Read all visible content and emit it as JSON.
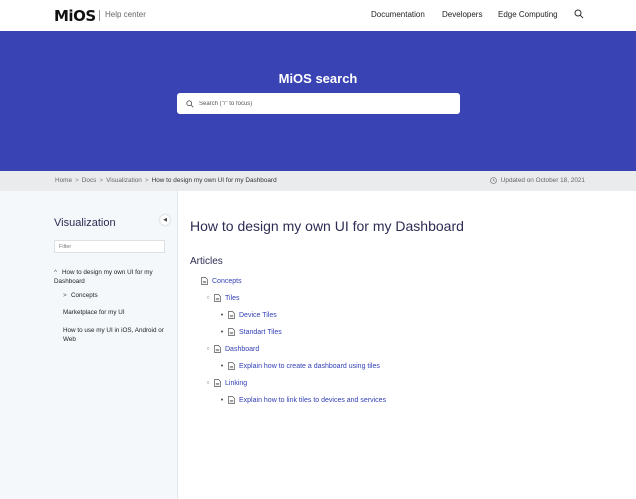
{
  "header": {
    "logo": "MiOS",
    "help_center": "Help center",
    "nav": [
      "Documentation",
      "Developers",
      "Edge Computing"
    ]
  },
  "hero": {
    "title": "MiOS search",
    "search_placeholder": "Search (\"/\" to focus)"
  },
  "breadcrumb": {
    "items": [
      "Home",
      "Docs",
      "Visualization",
      "How to design my own UI for my Dashboard"
    ],
    "updated": "Updated on October 18, 2021"
  },
  "sidebar": {
    "title": "Visualization",
    "filter_placeholder": "Filter",
    "items": [
      "How to design my own UI for my Dashboard",
      "Concepts",
      "Marketplace for my UI",
      "How to use my UI in iOS, Android or Web"
    ]
  },
  "main": {
    "title": "How to design my own UI for my Dashboard",
    "articles_heading": "Articles",
    "tree": [
      "Concepts",
      "Tiles",
      "Device Tiles",
      "Standart Tiles",
      "Dashboard",
      "Explain how to create a dashboard using tiles",
      "Linking",
      "Explain how to link tiles to devices and services"
    ]
  },
  "colors": {
    "hero_bg": "#3a43b3",
    "link": "#3340b6",
    "heading": "#2c2c54"
  }
}
